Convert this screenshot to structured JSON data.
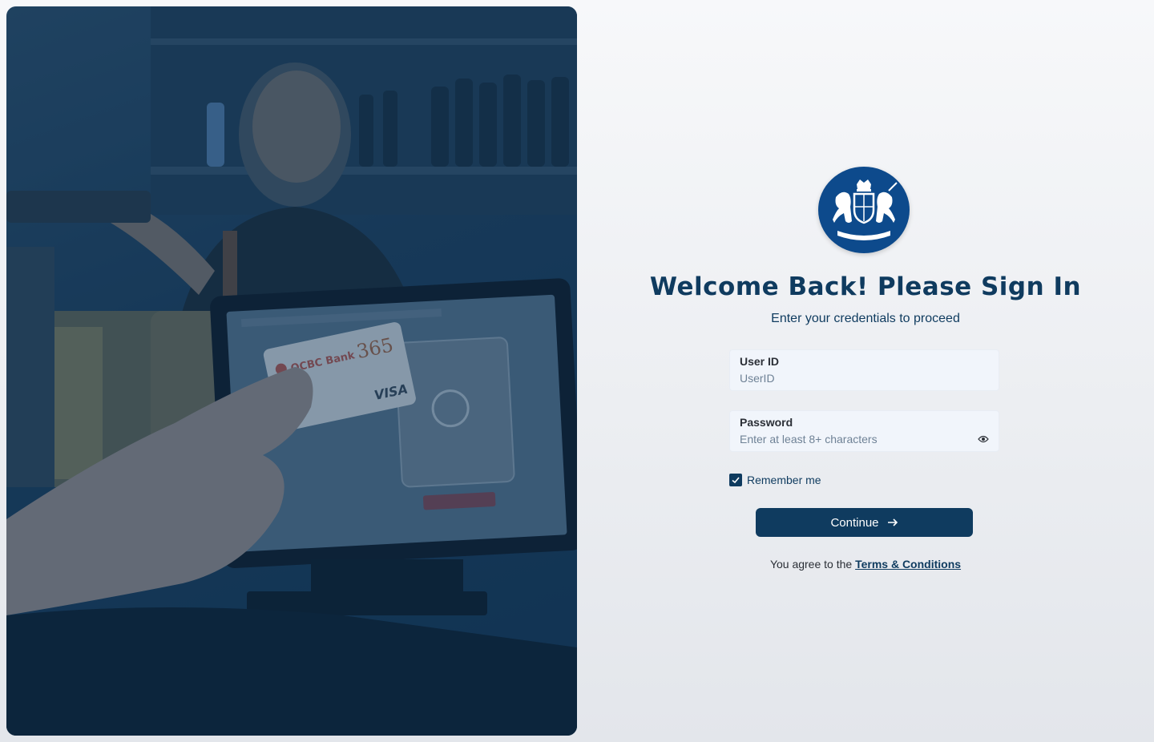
{
  "hero": {
    "image": "merchant-card-payment-terminal-photo",
    "card_bank_name": "OCBC Bank",
    "card_number_badge": "365",
    "card_network": "VISA"
  },
  "crest": {
    "icon": "royal-coat-of-arms-icon",
    "color": "#0d4a8c"
  },
  "title": "Welcome Back! Please Sign In",
  "subtitle": "Enter your credentials to proceed",
  "user_field": {
    "label": "User ID",
    "placeholder": "UserID",
    "value": ""
  },
  "password_field": {
    "label": "Password",
    "placeholder": "Enter at least 8+ characters",
    "value": "",
    "toggle_icon": "eye-icon"
  },
  "remember": {
    "label": "Remember me",
    "checked": true
  },
  "continue": {
    "label": "Continue",
    "icon": "arrow-right-icon"
  },
  "terms": {
    "prefix": "You agree to the",
    "link_text": "Terms & Conditions"
  },
  "colors": {
    "primary": "#0f3b5f",
    "field_bg": "#f1f5fb"
  }
}
